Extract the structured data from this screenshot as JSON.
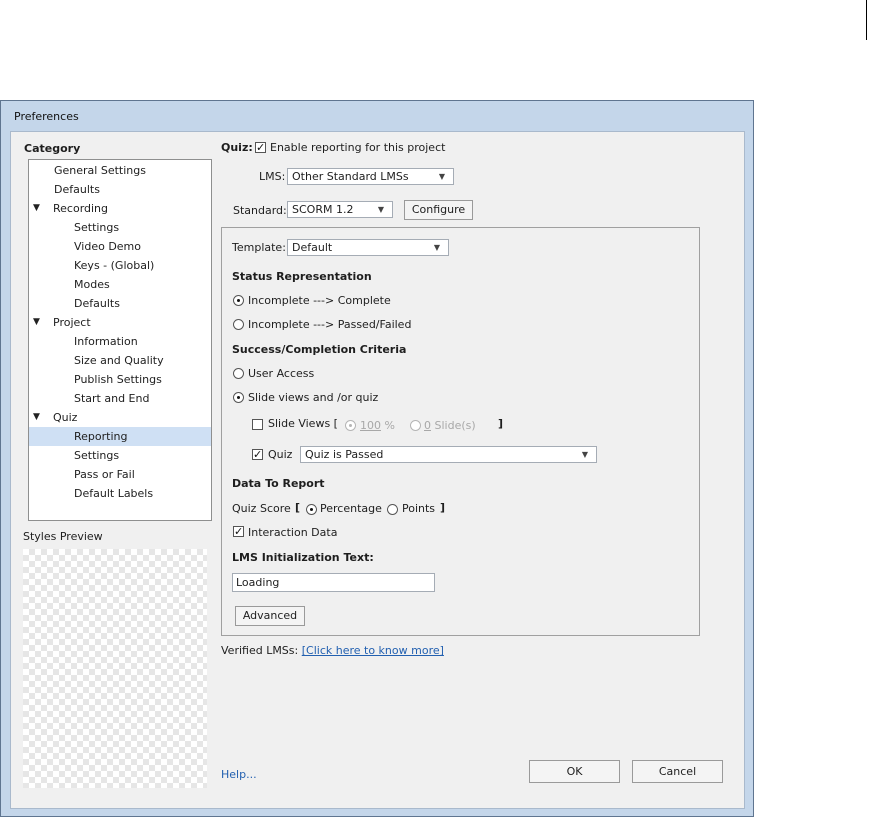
{
  "dialog": {
    "title": "Preferences"
  },
  "category": {
    "heading": "Category",
    "items": [
      {
        "label": "General Settings",
        "level": 1
      },
      {
        "label": "Defaults",
        "level": 1
      },
      {
        "label": "Recording",
        "level": 0,
        "expanded": true
      },
      {
        "label": "Settings",
        "level": 2
      },
      {
        "label": "Video Demo",
        "level": 2
      },
      {
        "label": "Keys - (Global)",
        "level": 2
      },
      {
        "label": "Modes",
        "level": 2
      },
      {
        "label": "Defaults",
        "level": 2
      },
      {
        "label": "Project",
        "level": 0,
        "expanded": true
      },
      {
        "label": "Information",
        "level": 2
      },
      {
        "label": "Size and Quality",
        "level": 2
      },
      {
        "label": "Publish Settings",
        "level": 2
      },
      {
        "label": "Start and End",
        "level": 2
      },
      {
        "label": "Quiz",
        "level": 0,
        "expanded": true
      },
      {
        "label": "Reporting",
        "level": 2,
        "selected": true
      },
      {
        "label": "Settings",
        "level": 2
      },
      {
        "label": "Pass or Fail",
        "level": 2
      },
      {
        "label": "Default Labels",
        "level": 2
      }
    ],
    "expand_glyph": "▼"
  },
  "styles_preview": {
    "label": "Styles Preview"
  },
  "quiz": {
    "label": "Quiz:",
    "enable_reporting": {
      "label": "Enable reporting for this project",
      "checked": true
    },
    "lms": {
      "label": "LMS:",
      "value": "Other Standard LMSs"
    },
    "standard": {
      "label": "Standard:",
      "value": "SCORM 1.2"
    },
    "configure_label": "Configure",
    "template": {
      "label": "Template:",
      "value": "Default"
    },
    "status_representation": {
      "heading": "Status Representation",
      "option_complete": "Incomplete ---> Complete",
      "option_passed_failed": "Incomplete ---> Passed/Failed",
      "selected": "complete"
    },
    "criteria": {
      "heading": "Success/Completion Criteria",
      "option_user_access": "User Access",
      "option_slide_views_quiz": "Slide views and /or quiz",
      "selected": "slide_views_quiz",
      "slide_views": {
        "label": "Slide Views [",
        "checked": false,
        "percent_value": "100",
        "percent_unit": "%",
        "slides_value": "0",
        "slides_unit": "Slide(s)",
        "close_bracket": "]"
      },
      "quiz": {
        "label": "Quiz",
        "checked": true,
        "value": "Quiz is Passed"
      }
    },
    "data_to_report": {
      "heading": "Data To Report",
      "quiz_score_label": "Quiz Score",
      "open_bracket": "[",
      "option_percentage": "Percentage",
      "option_points": "Points",
      "close_bracket": "]",
      "selected": "percentage",
      "interaction_data": {
        "label": "Interaction Data",
        "checked": true
      }
    },
    "lms_init": {
      "heading": "LMS Initialization Text:",
      "value": "Loading"
    },
    "advanced_label": "Advanced",
    "verified_lms": {
      "label": "Verified LMSs:",
      "link": "[Click here to know more]"
    }
  },
  "footer": {
    "help": "Help...",
    "ok": "OK",
    "cancel": "Cancel"
  },
  "glyphs": {
    "check": "✓",
    "dropdown": "▼"
  }
}
